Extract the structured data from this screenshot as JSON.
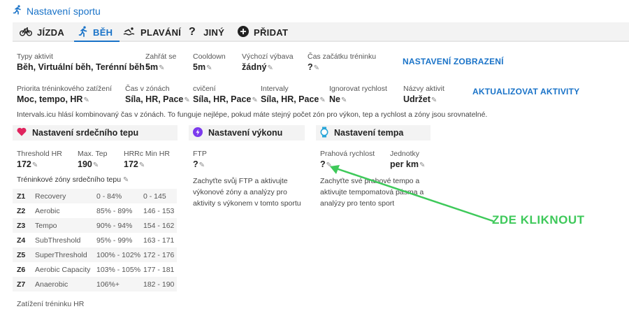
{
  "header": {
    "title": "Nastavení sportu"
  },
  "tabs": [
    {
      "label": "JÍZDA"
    },
    {
      "label": "BĚH"
    },
    {
      "label": "PLAVÁNÍ"
    },
    {
      "label": "JINÝ"
    },
    {
      "label": "PŘIDAT"
    }
  ],
  "row1": {
    "activity_types": {
      "label": "Typy aktivit",
      "value": "Běh, Virtuální běh, Terénní běh"
    },
    "warmup": {
      "label": "Zahřát se",
      "value": "5m"
    },
    "cooldown": {
      "label": "Cooldown",
      "value": "5m"
    },
    "default_gear": {
      "label": "Výchozí výbava",
      "value": "žádný"
    },
    "start_time": {
      "label": "Čas začátku tréninku",
      "value": "?"
    },
    "display_settings_link": "NASTAVENÍ ZOBRAZENÍ"
  },
  "row2": {
    "load_priority": {
      "label": "Priorita tréninkového zatížení",
      "value": "Moc, tempo, HR"
    },
    "time_in_zones": {
      "label": "Čas v zónách",
      "value": "Síla, HR, Pace"
    },
    "exercise": {
      "label": "cvičení",
      "value": "Síla, HR, Pace"
    },
    "intervals": {
      "label": "Intervaly",
      "value": "Síla, HR, Pace"
    },
    "ignore_speed": {
      "label": "Ignorovat rychlost",
      "value": "Ne"
    },
    "activity_names": {
      "label": "Názvy aktivit",
      "value": "Udržet"
    },
    "update_activities_link": "AKTUALIZOVAT AKTIVITY"
  },
  "note": "Intervals.icu hlásí kombinovaný čas v zónách. To funguje nejlépe, pokud máte stejný počet zón pro výkon, tep a rychlost a zóny jsou srovnatelné.",
  "hr_panel": {
    "title": "Nastavení srdečního tepu",
    "threshold": {
      "label": "Threshold HR",
      "value": "172"
    },
    "max": {
      "label": "Max. Tep",
      "value": "190"
    },
    "hrrc_min": {
      "label": "HRRc Min HR",
      "value": "172"
    },
    "zones_title": "Tréninkové zóny srdečního tepu",
    "zones": [
      {
        "id": "Z1",
        "name": "Recovery",
        "pct": "0 - 84%",
        "bpm": "0 - 145"
      },
      {
        "id": "Z2",
        "name": "Aerobic",
        "pct": "85% - 89%",
        "bpm": "146 - 153"
      },
      {
        "id": "Z3",
        "name": "Tempo",
        "pct": "90% - 94%",
        "bpm": "154 - 162"
      },
      {
        "id": "Z4",
        "name": "SubThreshold",
        "pct": "95% - 99%",
        "bpm": "163 - 171"
      },
      {
        "id": "Z5",
        "name": "SuperThreshold",
        "pct": "100% - 102%",
        "bpm": "172 - 176"
      },
      {
        "id": "Z6",
        "name": "Aerobic Capacity",
        "pct": "103% - 105%",
        "bpm": "177 - 181"
      },
      {
        "id": "Z7",
        "name": "Anaerobic",
        "pct": "106%+",
        "bpm": "182 - 190"
      }
    ]
  },
  "power_panel": {
    "title": "Nastavení výkonu",
    "ftp": {
      "label": "FTP",
      "value": "?"
    },
    "description": "Zachyťte svůj FTP a aktivujte výkonové zóny a analýzy pro aktivity s výkonem v tomto sportu"
  },
  "pace_panel": {
    "title": "Nastavení tempa",
    "threshold_pace": {
      "label": "Prahová rychlost",
      "value": "?"
    },
    "units": {
      "label": "Jednotky",
      "value": "per km"
    },
    "description": "Zachyťte své prahové tempo a aktivujte tempomatová pásma a analýzy pro tento sport"
  },
  "footer_label": "Zatížení tréninku HR",
  "annotation": "ZDE KLIKNOUT",
  "colors": {
    "accent": "#1a73c8",
    "annotation": "#3ec95a",
    "heart": "#e0245e",
    "power": "#7c3aed",
    "pace": "#2aa6d8"
  }
}
